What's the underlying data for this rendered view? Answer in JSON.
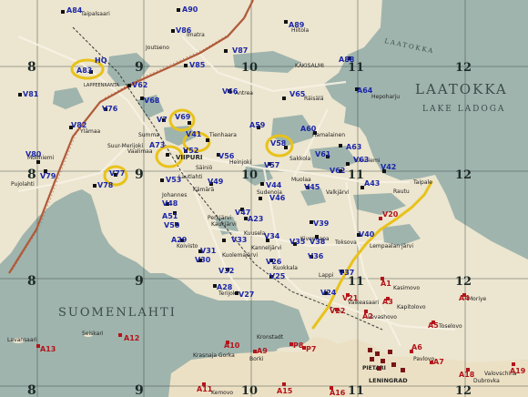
{
  "water_labels": {
    "laatokka": "LAATOKKA",
    "lake_ladoga": "LAKE LADOGA",
    "suomenlahti": "SUOMENLAHTI",
    "laatokka_small": "LAATOKKA"
  },
  "grid_labels": [
    {
      "id": "g8a",
      "text": "8"
    },
    {
      "id": "g8b",
      "text": "8"
    },
    {
      "id": "g8c",
      "text": "8"
    },
    {
      "id": "g8d",
      "text": "8"
    },
    {
      "id": "g9a",
      "text": "9"
    },
    {
      "id": "g9b",
      "text": "9"
    },
    {
      "id": "g9c",
      "text": "9"
    },
    {
      "id": "g9d",
      "text": "9"
    },
    {
      "id": "g10a",
      "text": "10"
    },
    {
      "id": "g10b",
      "text": "10"
    },
    {
      "id": "g10c",
      "text": "10"
    },
    {
      "id": "g11a",
      "text": "11"
    },
    {
      "id": "g11b",
      "text": "11"
    },
    {
      "id": "g11c",
      "text": "11"
    },
    {
      "id": "g11d",
      "text": "11"
    },
    {
      "id": "g12a",
      "text": "12"
    },
    {
      "id": "g12b",
      "text": "12"
    },
    {
      "id": "g12c",
      "text": "12"
    },
    {
      "id": "g12d",
      "text": "12"
    }
  ],
  "places": [
    {
      "id": "p1",
      "text": "Taipalsaari"
    },
    {
      "id": "p2",
      "text": "Joutseno"
    },
    {
      "id": "p3",
      "text": "Imatra"
    },
    {
      "id": "p4",
      "text": "Hiitola"
    },
    {
      "id": "p5",
      "text": "KÄKISALMI"
    },
    {
      "id": "p6",
      "text": "LAPPEENRANTA"
    },
    {
      "id": "p7",
      "text": "Antrea"
    },
    {
      "id": "p8",
      "text": "Räisälä"
    },
    {
      "id": "p9",
      "text": "Hepoharju"
    },
    {
      "id": "p10",
      "text": "Ylämaa"
    },
    {
      "id": "p11",
      "text": "Vaalimaa"
    },
    {
      "id": "p12",
      "text": "Säiniö"
    },
    {
      "id": "p13",
      "text": "Hamalainen"
    },
    {
      "id": "p14",
      "text": "Kiviniemi"
    },
    {
      "id": "p15",
      "text": "Sakkola"
    },
    {
      "id": "p16",
      "text": "Taipale"
    },
    {
      "id": "p17",
      "text": "Mohniemi"
    },
    {
      "id": "p18",
      "text": "Pujolahti"
    },
    {
      "id": "p19",
      "text": "VIIPURI"
    },
    {
      "id": "p20",
      "text": "Heinjoki"
    },
    {
      "id": "p21",
      "text": "Muolaa"
    },
    {
      "id": "p22",
      "text": "Valkjärvi"
    },
    {
      "id": "p23",
      "text": "Rautu"
    },
    {
      "id": "p24",
      "text": "Johannes"
    },
    {
      "id": "p25",
      "text": "Kämärä"
    },
    {
      "id": "p26",
      "text": "Sudenoja"
    },
    {
      "id": "p27",
      "text": "Perkjärvi"
    },
    {
      "id": "p28",
      "text": "Kaukjärvi"
    },
    {
      "id": "p29",
      "text": "Koivisto"
    },
    {
      "id": "p30",
      "text": "Kuolemajärvi"
    },
    {
      "id": "p31",
      "text": "Kanneljärvi"
    },
    {
      "id": "p32",
      "text": "Kivennapa"
    },
    {
      "id": "p33",
      "text": "Toksova"
    },
    {
      "id": "p34",
      "text": "Lempaalan järvi"
    },
    {
      "id": "p35",
      "text": "Terijoki"
    },
    {
      "id": "p36",
      "text": "Kuokkala"
    },
    {
      "id": "p37",
      "text": "Kuusela"
    },
    {
      "id": "p38",
      "text": "Lappi"
    },
    {
      "id": "p39",
      "text": "Valkeasaari"
    },
    {
      "id": "p40",
      "text": "Kasimovo"
    },
    {
      "id": "p41",
      "text": "Kapitolovo"
    },
    {
      "id": "p42",
      "text": "Levashovo"
    },
    {
      "id": "p43",
      "text": "Toselovo"
    },
    {
      "id": "p44",
      "text": "Moriye"
    },
    {
      "id": "p45",
      "text": "Lavansaari"
    },
    {
      "id": "p46",
      "text": "Seiskari"
    },
    {
      "id": "p47",
      "text": "Krasnaja Gorka"
    },
    {
      "id": "p48",
      "text": "Kronstadt"
    },
    {
      "id": "p49",
      "text": "Borki"
    },
    {
      "id": "p50",
      "text": "PIETARI"
    },
    {
      "id": "p51",
      "text": "LENINGRAD"
    },
    {
      "id": "p52",
      "text": "Pavlovo"
    },
    {
      "id": "p53",
      "text": "Valovschina"
    },
    {
      "id": "p54",
      "text": "Dubrovka"
    },
    {
      "id": "p55",
      "text": "Kemovo"
    },
    {
      "id": "p56",
      "text": "Suur-Merijoki"
    },
    {
      "id": "p57",
      "text": "Tienhaara"
    },
    {
      "id": "p58",
      "text": "Lautlahti"
    },
    {
      "id": "p59",
      "text": "Summa"
    }
  ],
  "markers_blue": [
    {
      "id": "A84",
      "text": "A84"
    },
    {
      "id": "A90",
      "text": "A90"
    },
    {
      "id": "V86",
      "text": "V86"
    },
    {
      "id": "A89",
      "text": "A89"
    },
    {
      "id": "V87",
      "text": "V87"
    },
    {
      "id": "A88",
      "text": "A88"
    },
    {
      "id": "A83",
      "text": "A83"
    },
    {
      "id": "HQ",
      "text": "HQ"
    },
    {
      "id": "V85",
      "text": "V85"
    },
    {
      "id": "V81",
      "text": "V81"
    },
    {
      "id": "V62",
      "text": "V62"
    },
    {
      "id": "V68",
      "text": "V68"
    },
    {
      "id": "V66",
      "text": "V66"
    },
    {
      "id": "V65",
      "text": "V65"
    },
    {
      "id": "A64",
      "text": "A64"
    },
    {
      "id": "V76",
      "text": "V76"
    },
    {
      "id": "V82",
      "text": "V82"
    },
    {
      "id": "V69",
      "text": "V69"
    },
    {
      "id": "V7",
      "text": "V7"
    },
    {
      "id": "A59",
      "text": "A59"
    },
    {
      "id": "A60",
      "text": "A60"
    },
    {
      "id": "V41",
      "text": "V41"
    },
    {
      "id": "V58",
      "text": "V58"
    },
    {
      "id": "A63",
      "text": "A63"
    },
    {
      "id": "A73",
      "text": "A73"
    },
    {
      "id": "V52",
      "text": "V52"
    },
    {
      "id": "V80",
      "text": "V80"
    },
    {
      "id": "V79",
      "text": "V79"
    },
    {
      "id": "V78",
      "text": "V78"
    },
    {
      "id": "V53",
      "text": "V53"
    },
    {
      "id": "V77",
      "text": "V77"
    },
    {
      "id": "V56",
      "text": "V56"
    },
    {
      "id": "V57",
      "text": "V57"
    },
    {
      "id": "V61",
      "text": "V61"
    },
    {
      "id": "V62b",
      "text": "V62"
    },
    {
      "id": "V42",
      "text": "V42"
    },
    {
      "id": "V63",
      "text": "V63"
    },
    {
      "id": "V49",
      "text": "V49"
    },
    {
      "id": "V45",
      "text": "V45"
    },
    {
      "id": "V44",
      "text": "V44"
    },
    {
      "id": "A43",
      "text": "A43"
    },
    {
      "id": "V48",
      "text": "V48"
    },
    {
      "id": "A51",
      "text": "A51"
    },
    {
      "id": "V50",
      "text": "V50"
    },
    {
      "id": "V47",
      "text": "V47"
    },
    {
      "id": "V46",
      "text": "V46"
    },
    {
      "id": "A23",
      "text": "A23"
    },
    {
      "id": "V39",
      "text": "V39"
    },
    {
      "id": "V40",
      "text": "V40"
    },
    {
      "id": "A29",
      "text": "A29"
    },
    {
      "id": "V33",
      "text": "V33"
    },
    {
      "id": "V34",
      "text": "V34"
    },
    {
      "id": "V35",
      "text": "V35"
    },
    {
      "id": "V31",
      "text": "V31"
    },
    {
      "id": "V38",
      "text": "V38"
    },
    {
      "id": "V30",
      "text": "V30"
    },
    {
      "id": "V36",
      "text": "V36"
    },
    {
      "id": "V26",
      "text": "V26"
    },
    {
      "id": "V25",
      "text": "V25"
    },
    {
      "id": "A28",
      "text": "A28"
    },
    {
      "id": "V27",
      "text": "V27"
    },
    {
      "id": "V32",
      "text": "V32"
    },
    {
      "id": "V24",
      "text": "V24"
    },
    {
      "id": "V37",
      "text": "V37"
    }
  ],
  "markers_red": [
    {
      "id": "V20",
      "text": "V20"
    },
    {
      "id": "A1",
      "text": "A1"
    },
    {
      "id": "V21",
      "text": "V21"
    },
    {
      "id": "A3",
      "text": "A3"
    },
    {
      "id": "A4",
      "text": "A4"
    },
    {
      "id": "V22",
      "text": "V22"
    },
    {
      "id": "A2",
      "text": "A2"
    },
    {
      "id": "A5",
      "text": "A5"
    },
    {
      "id": "A13",
      "text": "A13"
    },
    {
      "id": "A12",
      "text": "A12"
    },
    {
      "id": "A10",
      "text": "A10"
    },
    {
      "id": "A9",
      "text": "A9"
    },
    {
      "id": "P8",
      "text": "P8"
    },
    {
      "id": "P7",
      "text": "P7"
    },
    {
      "id": "A6",
      "text": "A6"
    },
    {
      "id": "A7",
      "text": "A7"
    },
    {
      "id": "A18",
      "text": "A18"
    },
    {
      "id": "A19",
      "text": "A19"
    },
    {
      "id": "A11",
      "text": "A11"
    },
    {
      "id": "A16",
      "text": "A16"
    },
    {
      "id": "A15",
      "text": "A15"
    }
  ],
  "colors": {
    "sea": "#9fb4ad",
    "land": "#ece5cf",
    "land_south": "#ece0c4",
    "road": "#f4efe0",
    "border": "#b05a3a",
    "frontline": "#e8c21a",
    "highlight": "#e8c21a",
    "marker_blue": "#1c27a8",
    "marker_red": "#b3141a",
    "grid": "#2b3a38"
  }
}
